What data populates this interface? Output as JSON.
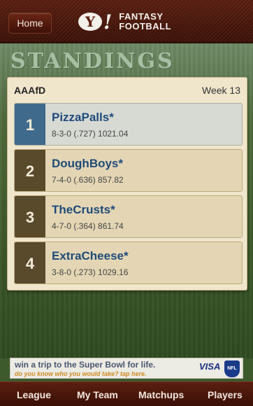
{
  "header": {
    "home_label": "Home",
    "logo_mark": "Y",
    "logo_bang": "!",
    "logo_line1": "FANTASY",
    "logo_line2": "FOOTBALL"
  },
  "page": {
    "title": "STANDINGS"
  },
  "standings": {
    "league": "AAAfD",
    "week": "Week 13",
    "teams": [
      {
        "rank": "1",
        "name": "PizzaPalls*",
        "record": "8-3-0 (.727) 1021.04"
      },
      {
        "rank": "2",
        "name": "DoughBoys*",
        "record": "7-4-0 (.636) 857.82"
      },
      {
        "rank": "3",
        "name": "TheCrusts*",
        "record": "4-7-0 (.364) 861.74"
      },
      {
        "rank": "4",
        "name": "ExtraCheese*",
        "record": "3-8-0 (.273) 1029.16"
      }
    ]
  },
  "ad": {
    "line1": "win a trip to the Super Bowl for life.",
    "line2": "do you know who you would take? tap here.",
    "brand": "VISA",
    "badge": "NFL"
  },
  "nav": {
    "items": [
      "League",
      "My Team",
      "Matchups",
      "Players"
    ]
  },
  "colors": {
    "header_bg": "#4a1a0c",
    "panel_bg": "#f0e6cc",
    "rank_active": "#3f6a8c",
    "rank_default": "#5a4a2c",
    "team_name": "#1e4a7a"
  }
}
